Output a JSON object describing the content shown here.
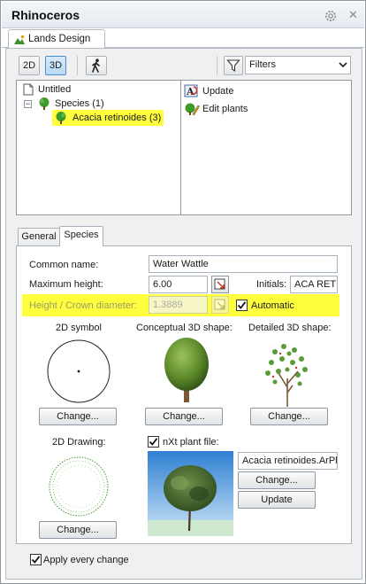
{
  "window": {
    "title": "Rhinoceros",
    "document_tab": "Lands Design"
  },
  "toolbar": {
    "btn_2d": "2D",
    "btn_3d": "3D",
    "filters_value": "Filters"
  },
  "tree": {
    "root": "Untitled",
    "category": "Species (1)",
    "selected_item": "Acacia retinoides (3)",
    "expander": "−"
  },
  "actions": {
    "update": "Update",
    "edit_plants": "Edit plants"
  },
  "tabs": {
    "general": "General",
    "species": "Species"
  },
  "form": {
    "common_name_label": "Common name:",
    "common_name_value": "Water Wattle",
    "max_height_label": "Maximum height:",
    "max_height_value": "6.00",
    "initials_label": "Initials:",
    "initials_value": "ACA RET",
    "ratio_label": "Height / Crown diameter:",
    "ratio_value": "1.3889",
    "automatic_label": "Automatic",
    "automatic_checked": true
  },
  "shapes": {
    "symbol_2d_label": "2D symbol",
    "conceptual_3d_label": "Conceptual 3D shape:",
    "detailed_3d_label": "Detailed 3D shape:",
    "drawing_2d_label": "2D Drawing:",
    "nxt_label": "nXt plant file:",
    "nxt_checked": true,
    "nxt_file": "Acacia retinoides.ArPl",
    "change_label": "Change...",
    "update_label": "Update"
  },
  "footer": {
    "apply_every_change": "Apply every change",
    "apply_checked": true
  },
  "colors": {
    "highlight": "#ffff3d",
    "selected_toggle": "#b9d9f6",
    "tree_green": "#3f9a2a"
  }
}
